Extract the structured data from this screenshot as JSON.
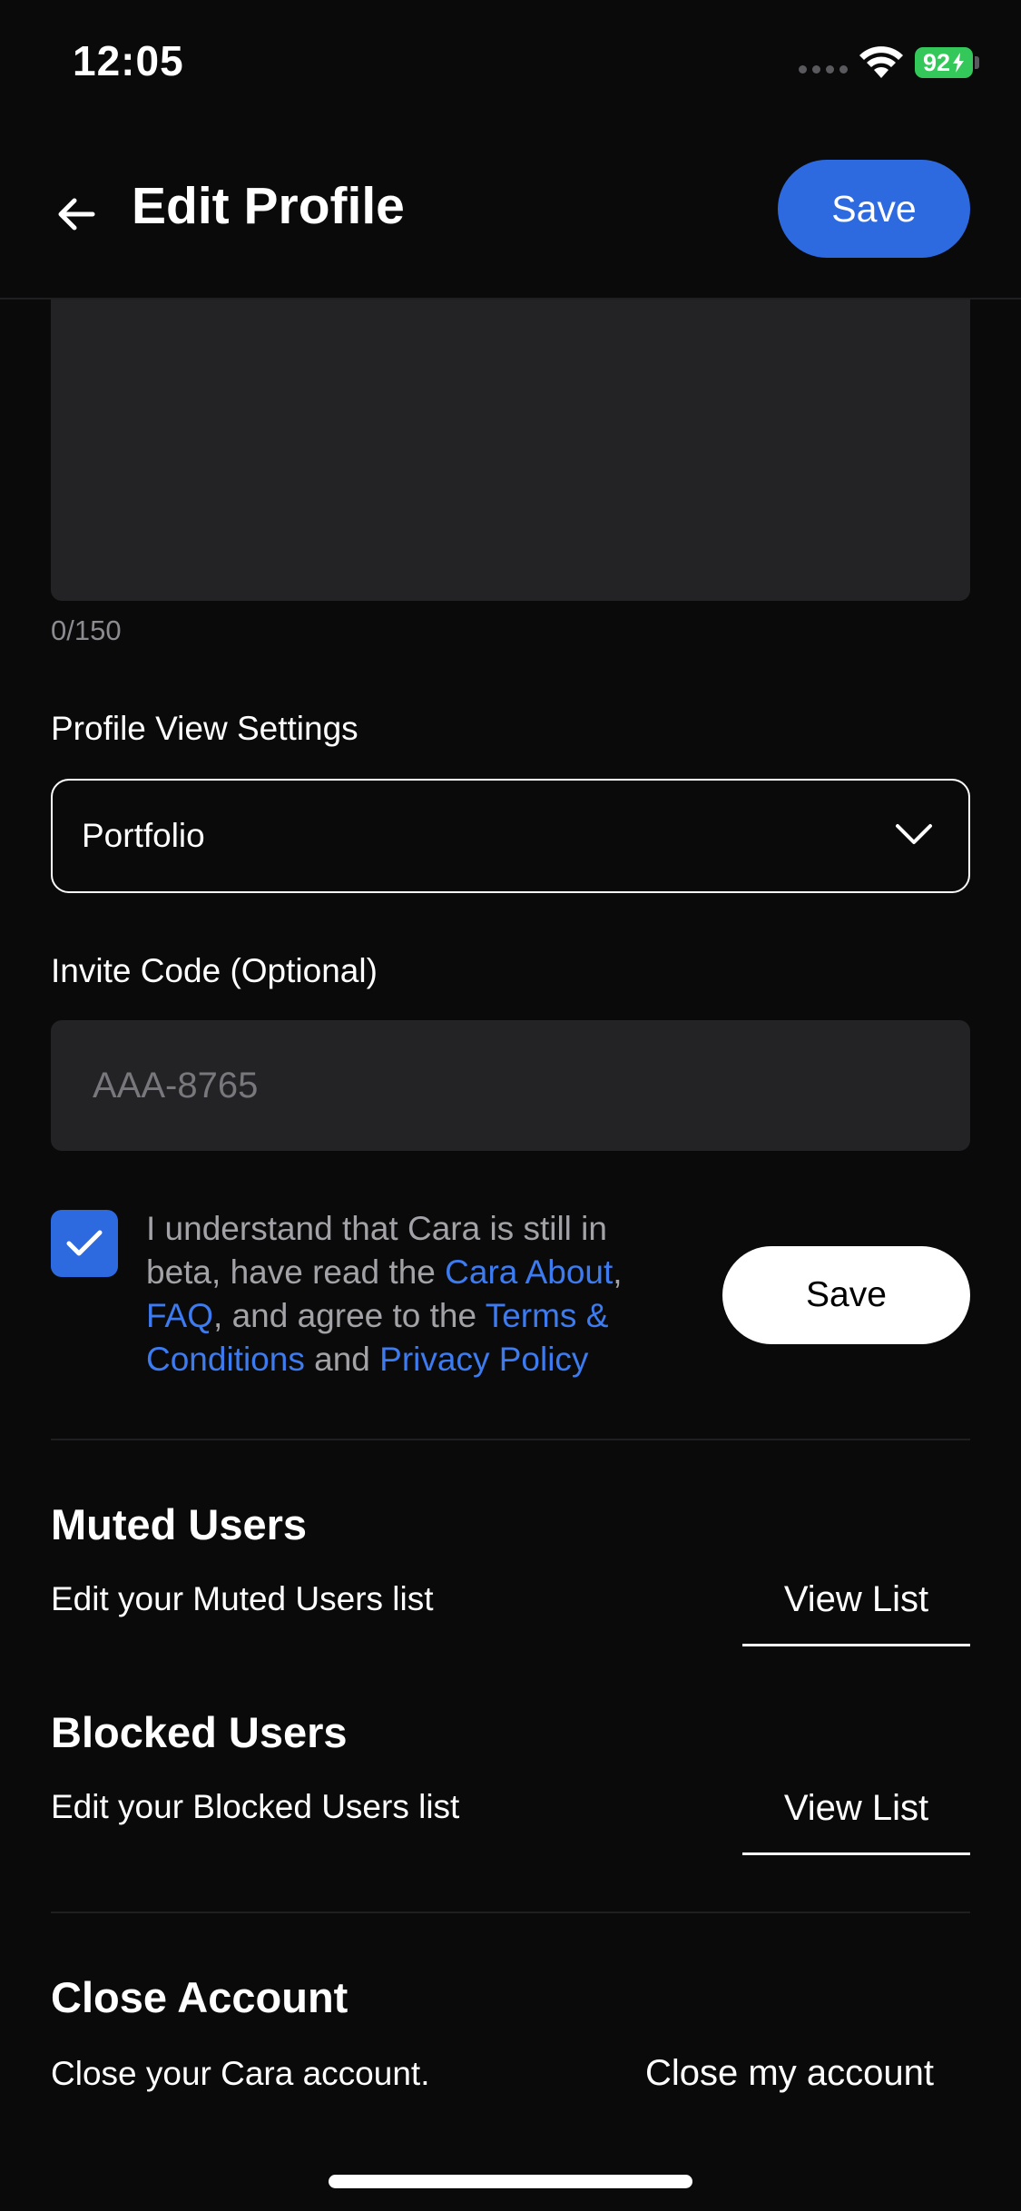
{
  "status_bar": {
    "time": "12:05",
    "battery": "92",
    "icons": [
      "signal-icon",
      "wifi-icon",
      "battery-icon"
    ]
  },
  "header": {
    "title": "Edit Profile",
    "save_label": "Save",
    "back_icon": "arrow-left-icon",
    "accent_color": "#2d6ae0"
  },
  "bio": {
    "char_count": "0/150"
  },
  "profile_view": {
    "label": "Profile View Settings",
    "selected": "Portfolio"
  },
  "invite": {
    "label": "Invite Code (Optional)",
    "placeholder": "AAA-8765",
    "value": ""
  },
  "terms": {
    "checked": true,
    "text_1": "I understand that Cara is still in beta, have read the ",
    "link_about": "Cara About",
    "text_2": ", ",
    "link_faq": "FAQ",
    "text_3": ", and agree to the ",
    "link_terms": "Terms & Conditions",
    "text_4": " and ",
    "link_privacy": "Privacy Policy",
    "save_label": "Save"
  },
  "muted": {
    "title": "Muted Users",
    "description": "Edit your Muted Users list",
    "button": "View List"
  },
  "blocked": {
    "title": "Blocked Users",
    "description": "Edit your Blocked Users list",
    "button": "View List"
  },
  "close_account": {
    "title": "Close Account",
    "description": "Close your Cara account.",
    "button": "Close my account"
  }
}
